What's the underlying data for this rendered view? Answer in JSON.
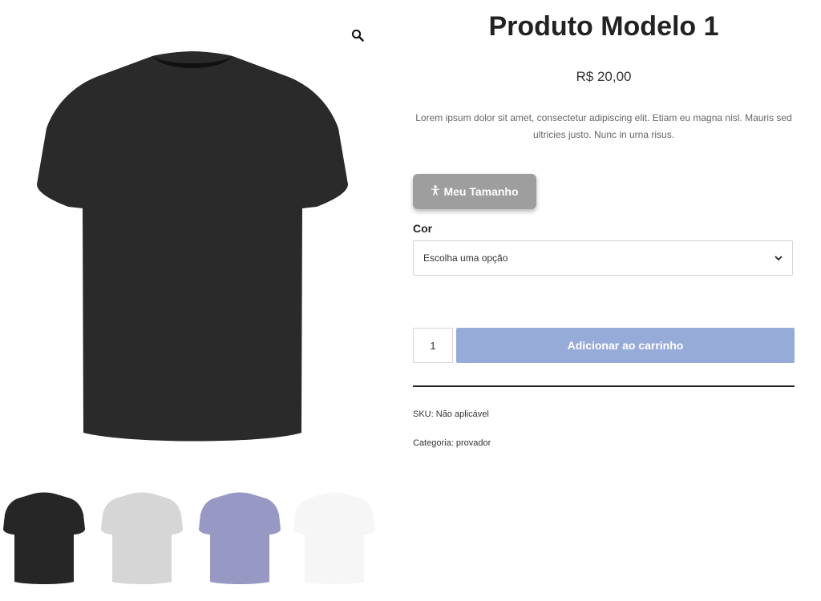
{
  "gallery": {
    "zoom_icon": "search-icon",
    "main_image": {
      "alt": "Camiseta preta",
      "color": "#2a2a2a"
    },
    "thumbnails": [
      {
        "name": "black",
        "color": "#262626"
      },
      {
        "name": "light-gray",
        "color": "#d6d6d6"
      },
      {
        "name": "lavender",
        "color": "#9798c4"
      },
      {
        "name": "white",
        "color": "#f6f6f6"
      }
    ]
  },
  "product": {
    "title": "Produto Modelo 1",
    "price": "R$ 20,00",
    "description": "Lorem ipsum dolor sit amet, consectetur adipiscing elit. Etiam eu magna nisl. Mauris sed ultricies justo. Nunc in urna risus."
  },
  "size_button": {
    "icon": "person-icon",
    "label": "Meu Tamanho",
    "bg": "#9e9e9e"
  },
  "color_option": {
    "label": "Cor",
    "selected": "Escolha uma opção"
  },
  "cart": {
    "quantity": "1",
    "button_label": "Adicionar ao carrinho",
    "button_bg": "#97abd9"
  },
  "meta": {
    "sku_label": "SKU:",
    "sku_value": "Não aplicável",
    "category_label": "Categoria:",
    "category_value": "provador"
  }
}
